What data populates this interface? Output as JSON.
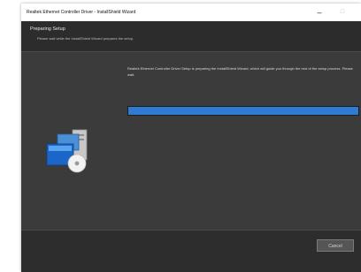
{
  "window": {
    "title": "Realtek Ethernet Controller Driver - InstallShield Wizard"
  },
  "controls": {
    "minimize": "–",
    "maximize": "□"
  },
  "header": {
    "step": "Preparing Setup",
    "description": "Please wait while the InstallShield Wizard prepares the setup."
  },
  "status": {
    "text": "Realtek Ethernet Controller Driver Setup is preparing the InstallShield Wizard, which will guide you through the rest of the setup process. Please wait."
  },
  "progress": {
    "percent": 100,
    "color": "#2e7bd1"
  },
  "footer": {
    "cancel_label": "Cancel"
  },
  "icons": {
    "setup": "setup-computer-icon"
  }
}
